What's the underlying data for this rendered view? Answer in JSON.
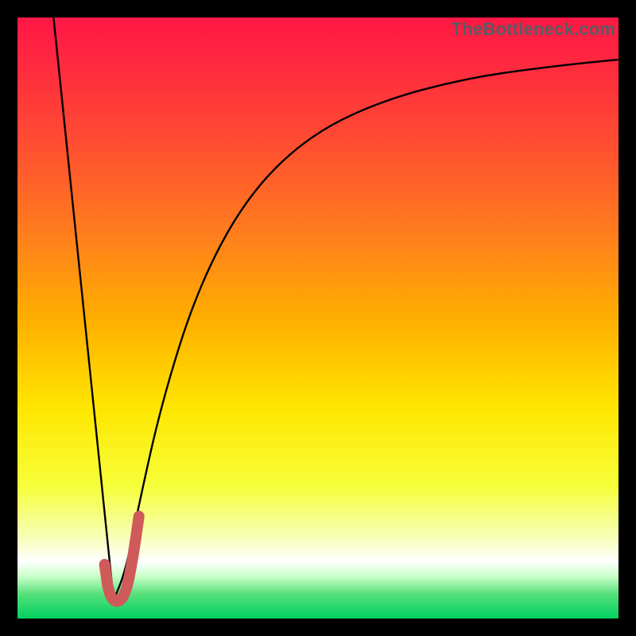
{
  "watermark": "TheBottleneck.com",
  "colors": {
    "frame": "#000000",
    "curve": "#000000",
    "highlight": "#cf5a5a",
    "gradient_stops": [
      {
        "offset": 0.0,
        "color": "#ff1744"
      },
      {
        "offset": 0.08,
        "color": "#ff2a3f"
      },
      {
        "offset": 0.2,
        "color": "#ff4a32"
      },
      {
        "offset": 0.35,
        "color": "#ff7a1f"
      },
      {
        "offset": 0.5,
        "color": "#ffae00"
      },
      {
        "offset": 0.65,
        "color": "#ffe600"
      },
      {
        "offset": 0.78,
        "color": "#f6ff3a"
      },
      {
        "offset": 0.86,
        "color": "#f6ffb0"
      },
      {
        "offset": 0.905,
        "color": "#ffffff"
      },
      {
        "offset": 0.93,
        "color": "#c8ffc8"
      },
      {
        "offset": 0.96,
        "color": "#55e07a"
      },
      {
        "offset": 1.0,
        "color": "#00d060"
      }
    ]
  },
  "chart_data": {
    "type": "line",
    "title": "",
    "xlabel": "",
    "ylabel": "",
    "xlim": [
      0,
      100
    ],
    "ylim": [
      0,
      100
    ],
    "grid": false,
    "series": [
      {
        "name": "bottleneck-curve",
        "x_left": [
          6,
          16
        ],
        "y_left": [
          100,
          3
        ],
        "vertex": {
          "x": 16,
          "y": 3
        },
        "right_curve": [
          {
            "x": 16,
            "y": 3
          },
          {
            "x": 18,
            "y": 8
          },
          {
            "x": 20,
            "y": 18
          },
          {
            "x": 24,
            "y": 36
          },
          {
            "x": 30,
            "y": 55
          },
          {
            "x": 38,
            "y": 70
          },
          {
            "x": 48,
            "y": 80
          },
          {
            "x": 60,
            "y": 86
          },
          {
            "x": 75,
            "y": 90
          },
          {
            "x": 90,
            "y": 92
          },
          {
            "x": 100,
            "y": 93
          }
        ]
      },
      {
        "name": "highlight-hook",
        "points": [
          {
            "x": 14.5,
            "y": 9
          },
          {
            "x": 15.2,
            "y": 4
          },
          {
            "x": 16.5,
            "y": 2.5
          },
          {
            "x": 18.0,
            "y": 4
          },
          {
            "x": 19.2,
            "y": 10
          },
          {
            "x": 20.2,
            "y": 17
          }
        ]
      }
    ]
  }
}
